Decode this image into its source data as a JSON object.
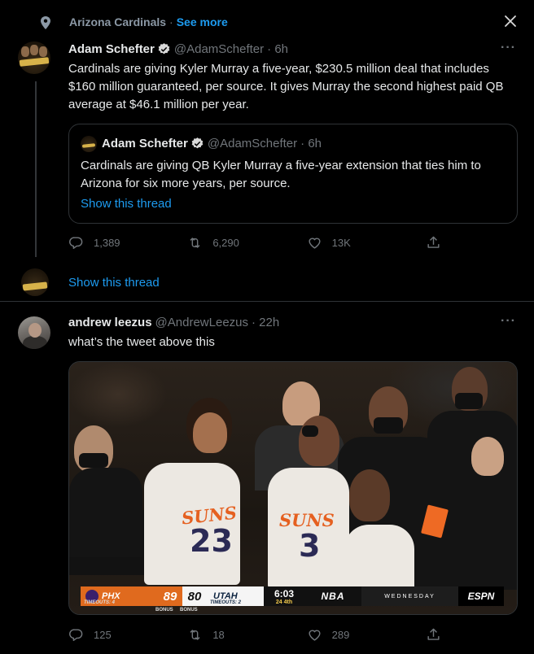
{
  "context": {
    "name": "Arizona Cardinals",
    "separator": "·",
    "see_more": "See more"
  },
  "tweet1": {
    "display_name": "Adam Schefter",
    "handle": "@AdamSchefter",
    "time": "· 6h",
    "text": "Cardinals are giving Kyler Murray a five-year, $230.5 million deal that includes $160 million guaranteed, per source. It gives Murray the second highest paid QB average at $46.1 million per year.",
    "quote": {
      "display_name": "Adam Schefter",
      "handle": "@AdamSchefter",
      "time": "· 6h",
      "text": "Cardinals are giving QB Kyler Murray a five-year extension that ties him to Arizona for six more years, per source.",
      "show_thread": "Show this thread"
    },
    "replies": "1,389",
    "retweets": "6,290",
    "likes": "13K",
    "show_thread": "Show this thread"
  },
  "tweet2": {
    "display_name": "andrew leezus",
    "handle": "@AndrewLeezus",
    "time": "· 22h",
    "text": "what’s the tweet above this",
    "replies": "125",
    "retweets": "18",
    "likes": "289",
    "media": {
      "jersey_numbers": [
        "23",
        "3"
      ],
      "jersey_text": "SUNS",
      "scorebug": {
        "home_team": "PHX",
        "home_score": "89",
        "away_score": "80",
        "away_team": "UTAH",
        "clock": "6:03",
        "period": "24  4th",
        "timeouts_home": "TIMEOUTS: 4",
        "bonus1": "BONUS",
        "bonus2": "BONUS",
        "timeouts_away": "TIMEOUTS: 2",
        "league": "NBA",
        "day": "WEDNESDAY",
        "network": "ESPN"
      }
    }
  },
  "colors": {
    "accent": "#1d9bf0",
    "muted": "#71767b",
    "background": "#000000",
    "border": "#2f3336"
  },
  "icons": [
    "location-pin-icon",
    "close-icon",
    "more-icon",
    "verified-badge-icon",
    "reply-icon",
    "retweet-icon",
    "like-icon",
    "share-icon"
  ]
}
